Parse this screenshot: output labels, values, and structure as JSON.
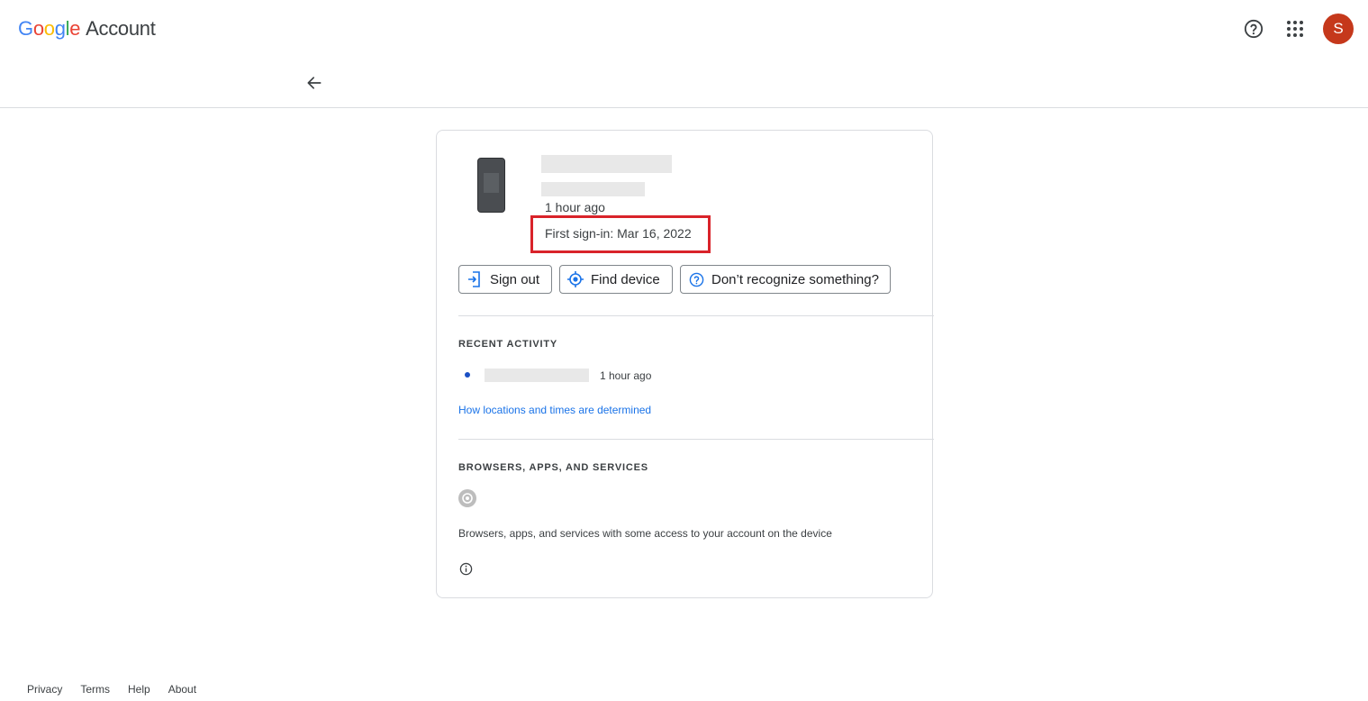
{
  "header": {
    "logo_letters": [
      "G",
      "o",
      "o",
      "g",
      "l",
      "e"
    ],
    "logo_suffix": "Account",
    "avatar_initial": "S",
    "avatar_color": "#c5381b",
    "icons": {
      "help": "help-circle-icon",
      "apps": "apps-grid-icon",
      "back": "arrow-back-icon"
    }
  },
  "device": {
    "last_active": "1 hour ago",
    "first_signin": "First sign-in: Mar 16, 2022",
    "icon": "phone-icon",
    "highlight_color": "#d9232a"
  },
  "actions": {
    "sign_out": "Sign out",
    "find_device": "Find device",
    "unrecognized": "Don’t recognize something?"
  },
  "recent_activity": {
    "title": "RECENT ACTIVITY",
    "items": [
      {
        "time": "1 hour ago"
      }
    ],
    "link": "How locations and times are determined"
  },
  "browsers": {
    "title": "BROWSERS, APPS, AND SERVICES",
    "description": "Browsers, apps, and services with some access to your account on the device"
  },
  "footer": {
    "links": [
      "Privacy",
      "Terms",
      "Help",
      "About"
    ]
  }
}
